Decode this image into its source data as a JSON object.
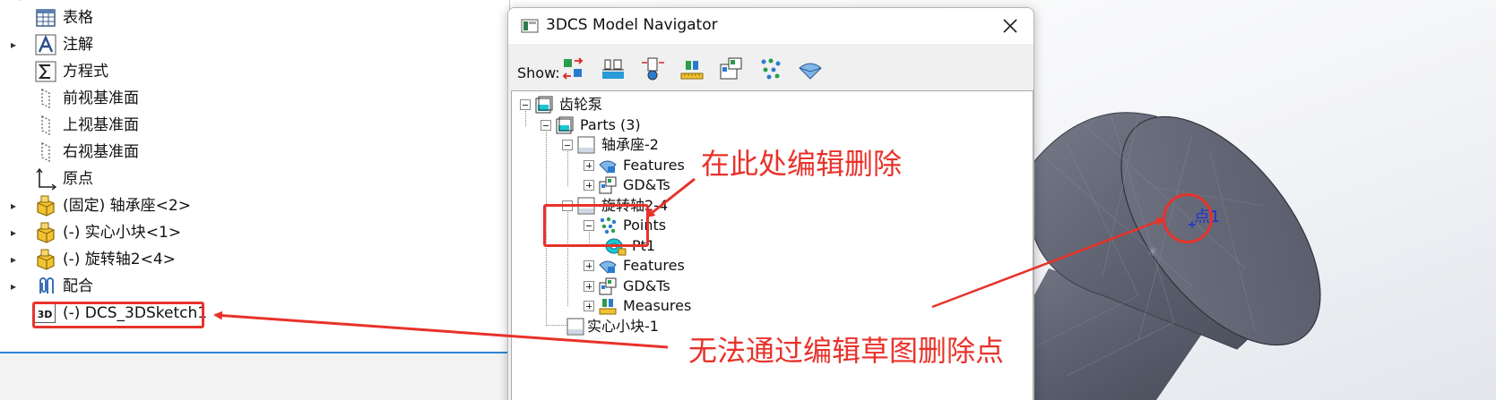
{
  "feature_tree": {
    "items": [
      {
        "label": "表格",
        "icon": "table-icon",
        "expander": ""
      },
      {
        "label": "注解",
        "icon": "annotation-icon",
        "expander": "▸"
      },
      {
        "label": "方程式",
        "icon": "equation-icon",
        "expander": ""
      },
      {
        "label": "前视基准面",
        "icon": "plane-icon",
        "expander": ""
      },
      {
        "label": "上视基准面",
        "icon": "plane-icon",
        "expander": ""
      },
      {
        "label": "右视基准面",
        "icon": "plane-icon",
        "expander": ""
      },
      {
        "label": "原点",
        "icon": "origin-icon",
        "expander": ""
      },
      {
        "label": "(固定) 轴承座<2>",
        "icon": "part-icon",
        "expander": "▸"
      },
      {
        "label": "(-) 实心小块<1>",
        "icon": "part-icon",
        "expander": "▸"
      },
      {
        "label": "(-) 旋转轴2<4>",
        "icon": "part-icon",
        "expander": "▸"
      },
      {
        "label": "配合",
        "icon": "mates-icon",
        "expander": "▸"
      },
      {
        "label": "(-) DCS_3DSketch1",
        "icon": "3d-sketch-icon",
        "expander": ""
      }
    ],
    "sketch_badge": "3D"
  },
  "navigator": {
    "title": "3DCS Model Navigator",
    "show_label": "Show:",
    "toolbar_buttons": [
      "parts-filter-icon",
      "features-filter-icon",
      "points-filter-icon",
      "measures-filter-icon",
      "gdt-filter-icon",
      "point-cloud-filter-icon",
      "surface-filter-icon"
    ],
    "tree": {
      "root": "齿轮泵",
      "parts": "Parts (3)",
      "part1": "轴承座-2",
      "part1_features": "Features",
      "part1_gdts": "GD&Ts",
      "part2": "旋转轴2-4",
      "part2_points": "Points",
      "part2_pt1": "Pt1",
      "part2_features": "Features",
      "part2_gdts": "GD&Ts",
      "part2_measures": "Measures",
      "part3": "实心小块-1"
    }
  },
  "viewport": {
    "point_label": "点1",
    "model_color": "#5d6170",
    "point_color": "#2233cc"
  },
  "annotations": {
    "edit_here": "在此处编辑删除",
    "cannot_delete": "无法通过编辑草图删除点",
    "color": "#e8322a"
  }
}
